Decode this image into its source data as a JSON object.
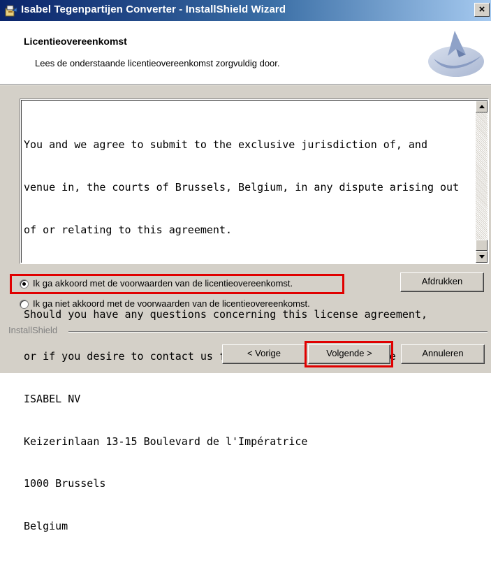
{
  "window": {
    "title": "Isabel Tegenpartijen Converter - InstallShield Wizard",
    "close_symbol": "×"
  },
  "header": {
    "title": "Licentieovereenkomst",
    "subtitle": "Lees de onderstaande licentieovereenkomst zorgvuldig door."
  },
  "license": {
    "lines": [
      "You and we agree to submit to the exclusive jurisdiction of, and",
      "venue in, the courts of Brussels, Belgium, in any dispute arising out",
      "of or relating to this agreement.",
      "",
      "Should you have any questions concerning this license agreement,",
      "or if you desire to contact us for any reason, please write to:",
      "ISABEL NV",
      "Keizerinlaan 13-15 Boulevard de l'Impératrice",
      "1000 Brussels",
      "Belgium"
    ]
  },
  "options": {
    "accept_label": "Ik ga akkoord met de voorwaarden van de licentieovereenkomst.",
    "decline_label": "Ik ga niet akkoord met de voorwaarden van de licentieovereenkomst.",
    "selected": "accept"
  },
  "buttons": {
    "print": "Afdrukken",
    "back": "< Vorige",
    "next": "Volgende >",
    "cancel": "Annuleren"
  },
  "footer": {
    "group_label": "InstallShield"
  },
  "colors": {
    "titlebar_start": "#0a246a",
    "titlebar_end": "#a6caf0",
    "dialog_bg": "#d4d0c8",
    "highlight": "#e00000"
  },
  "icons": {
    "app": "installer-package-icon",
    "logo": "installshield-logo",
    "close": "close-icon"
  }
}
